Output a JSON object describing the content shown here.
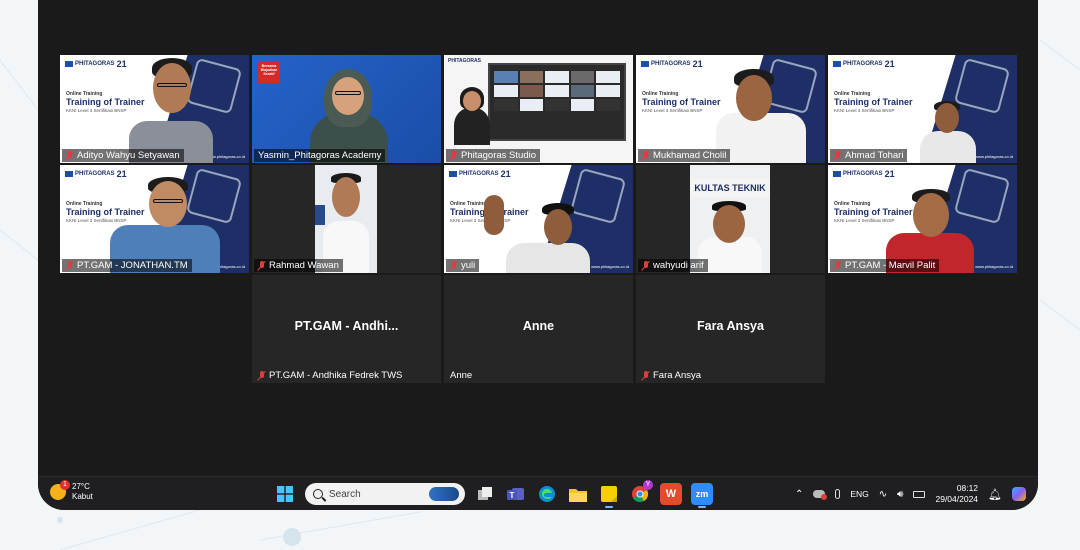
{
  "gallery": {
    "tiles": [
      {
        "name": "Adityo Wahyu Setyawan",
        "type": "slide",
        "muted": true
      },
      {
        "name": "Yasmin_Phitagoras Academy",
        "type": "host",
        "muted": false
      },
      {
        "name": "Phitagoras Studio",
        "type": "share",
        "muted": true
      },
      {
        "name": "Mukhamad Cholil",
        "type": "slide",
        "muted": true
      },
      {
        "name": "Ahmad Tohari",
        "type": "slide",
        "muted": true
      },
      {
        "name": "PT.GAM - JONATHAN.TM",
        "type": "slide",
        "muted": true
      },
      {
        "name": "Rahmad Wawan",
        "type": "video",
        "muted": true
      },
      {
        "name": "yuli",
        "type": "slide",
        "muted": true
      },
      {
        "name": "wahyudi arif",
        "type": "video",
        "muted": true
      },
      {
        "name": "PT.GAM - Marvil Palit",
        "type": "slide",
        "muted": true
      },
      {
        "name": "PT.GAM - Andhika Fedrek TWS",
        "display": "PT.GAM - Andhi...",
        "type": "noVideo",
        "muted": true
      },
      {
        "name": "Anne",
        "display": "Anne",
        "type": "noVideo",
        "muted": false
      },
      {
        "name": "Fara Ansya",
        "display": "Fara Ansya",
        "type": "noVideo",
        "muted": true
      }
    ],
    "slide": {
      "brand": "PHITAGORAS",
      "brand_num": "21",
      "kicker": "Online Training",
      "title": "Training of Trainer",
      "subtitle": "KKNI Level 3 Sertifikasi BNSP",
      "url": "www.phitagoras.co.id"
    },
    "host_badge": "Bersama Wujudkan Kreatif",
    "banner_text": "KULTAS TEKNIK"
  },
  "taskbar": {
    "weather_temp": "27°C",
    "weather_desc": "Kabut",
    "weather_badge": "1",
    "search_placeholder": "Search",
    "lang": "ENG",
    "time": "08:12",
    "date": "29/04/2024",
    "apps": [
      "start-icon",
      "search",
      "task-view-icon",
      "teams-icon",
      "edge-icon",
      "file-explorer-icon",
      "sticky-notes-icon",
      "chrome-icon",
      "wps-icon",
      "zoom-icon"
    ],
    "zoom_label": "zm",
    "wps_label": "W",
    "chrome_badge": "Y"
  },
  "colors": {
    "active_border": "#8bd44a",
    "slide_navy": "#1d2f66",
    "muted_red": "#e23b3b"
  }
}
